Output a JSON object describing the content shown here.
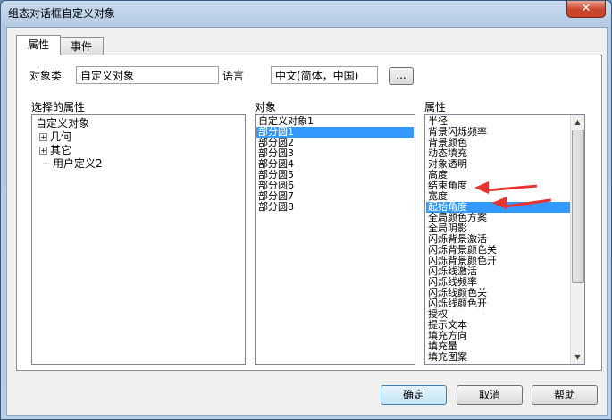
{
  "window": {
    "title": "组态对话框自定义对象",
    "close_label": "✕"
  },
  "tabs": [
    {
      "label": "属性"
    },
    {
      "label": "事件"
    }
  ],
  "form": {
    "object_class_label": "对象类",
    "object_class_value": "自定义对象",
    "language_label": "语言",
    "language_value": "中文(简体，中国)",
    "browse_label": "..."
  },
  "selected_props": {
    "header": "选择的属性",
    "root": "自定义对象",
    "items": [
      {
        "label": "几何",
        "expander": "+"
      },
      {
        "label": "其它",
        "expander": "+"
      },
      {
        "label": "用户定义2",
        "expander": ""
      }
    ]
  },
  "objects": {
    "header": "对象",
    "items": [
      "自定义对象1",
      "部分圆1",
      "部分圆2",
      "部分圆3",
      "部分圆4",
      "部分圆5",
      "部分圆6",
      "部分圆7",
      "部分圆8"
    ],
    "selected_index": 1
  },
  "properties": {
    "header": "属性",
    "items": [
      "半径",
      "背景闪烁频率",
      "背景颜色",
      "动态填充",
      "对象透明",
      "高度",
      "结束角度",
      "宽度",
      "起始角度",
      "全局颜色方案",
      "全局阴影",
      "闪烁背景激活",
      "闪烁背景颜色关",
      "闪烁背景颜色开",
      "闪烁线激活",
      "闪烁线频率",
      "闪烁线颜色关",
      "闪烁线颜色开",
      "授权",
      "提示文本",
      "填充方向",
      "填充量",
      "填充图案"
    ],
    "selected_index": 8,
    "highlight_color": "#3399ff",
    "annotation_color": "#e8332f"
  },
  "buttons": {
    "ok": "确定",
    "cancel": "取消",
    "help": "帮助"
  }
}
